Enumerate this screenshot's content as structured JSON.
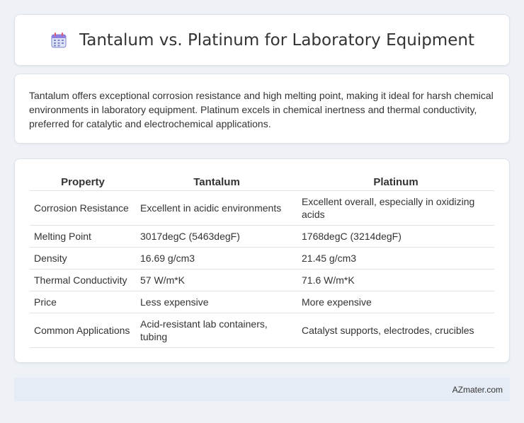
{
  "header": {
    "title": "Tantalum vs. Platinum for Laboratory Equipment",
    "icon": "calendar-icon"
  },
  "summary": {
    "text": "Tantalum offers exceptional corrosion resistance and high melting point, making it ideal for harsh chemical environments in laboratory equipment. Platinum excels in chemical inertness and thermal conductivity, preferred for catalytic and electrochemical applications."
  },
  "table": {
    "headers": [
      "Property",
      "Tantalum",
      "Platinum"
    ],
    "rows": [
      [
        "Corrosion Resistance",
        "Excellent in acidic environments",
        "Excellent overall, especially in oxidizing acids"
      ],
      [
        "Melting Point",
        "3017degC (5463degF)",
        "1768degC (3214degF)"
      ],
      [
        "Density",
        "16.69 g/cm3",
        "21.45 g/cm3"
      ],
      [
        "Thermal Conductivity",
        "57 W/m*K",
        "71.6 W/m*K"
      ],
      [
        "Price",
        "Less expensive",
        "More expensive"
      ],
      [
        "Common Applications",
        "Acid-resistant lab containers, tubing",
        "Catalyst supports, electrodes, crucibles"
      ]
    ]
  },
  "footer": {
    "brand": "AZmater.com"
  }
}
